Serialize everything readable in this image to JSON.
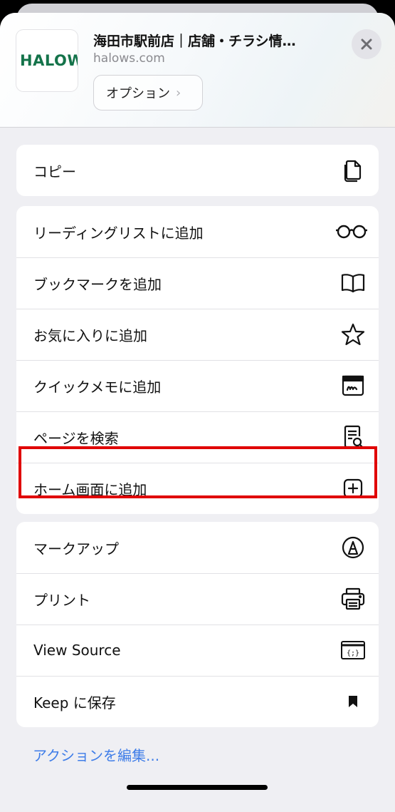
{
  "header": {
    "favicon_text": "HALOWS",
    "title": "海田市駅前店｜店舗・チラシ情…",
    "domain": "halows.com",
    "options_label": "オプション",
    "options_chevron": "›"
  },
  "groups": [
    {
      "items": [
        {
          "label": "コピー",
          "icon": "copy-icon"
        }
      ]
    },
    {
      "items": [
        {
          "label": "リーディングリストに追加",
          "icon": "glasses-icon"
        },
        {
          "label": "ブックマークを追加",
          "icon": "book-icon"
        },
        {
          "label": "お気に入りに追加",
          "icon": "star-icon"
        },
        {
          "label": "クイックメモに追加",
          "icon": "quick-note-icon"
        },
        {
          "label": "ページを検索",
          "icon": "find-in-page-icon"
        },
        {
          "label": "ホーム画面に追加",
          "icon": "add-square-icon"
        }
      ]
    },
    {
      "items": [
        {
          "label": "マークアップ",
          "icon": "markup-pen-icon"
        },
        {
          "label": "プリント",
          "icon": "printer-icon"
        },
        {
          "label": "View Source",
          "icon": "source-code-icon"
        },
        {
          "label": "Keep に保存",
          "icon": "bookmark-icon"
        }
      ]
    }
  ],
  "edit_actions_label": "アクションを編集...",
  "highlight_color": "#e00000",
  "link_color": "#3f7de8"
}
